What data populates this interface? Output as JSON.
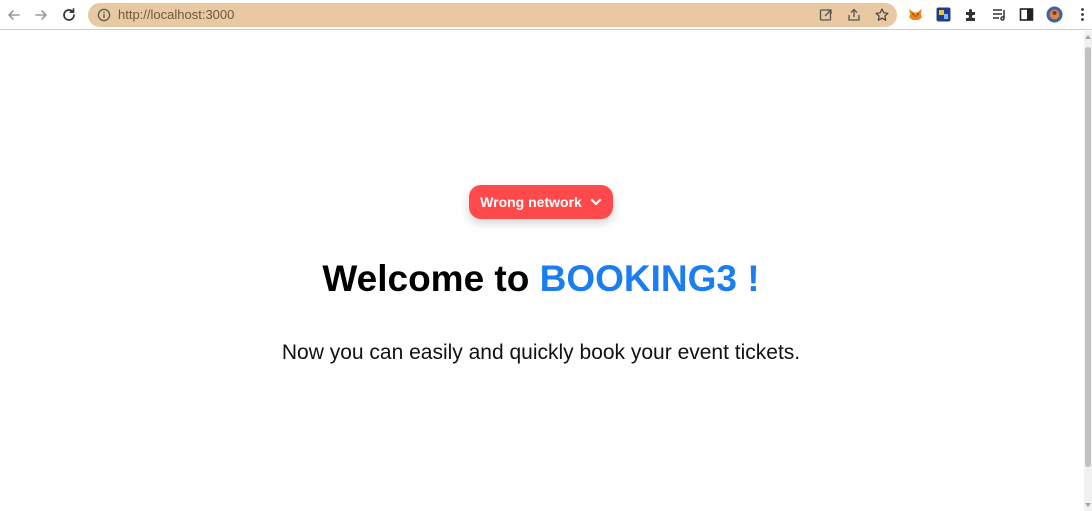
{
  "browser": {
    "url": "http://localhost:3000",
    "omnibox_color": "#e8c9a1"
  },
  "main": {
    "network_button_label": "Wrong network",
    "title_prefix": "Welcome to",
    "title_brand": "BOOKING3 !",
    "subtitle": "Now you can easily and quickly book your event tickets."
  },
  "colors": {
    "network_button": "#ff494a",
    "brand": "#1a7ef0"
  },
  "icons": {
    "back": "arrow-left-icon",
    "forward": "arrow-right-icon",
    "reload": "reload-icon",
    "site_info": "info-icon",
    "open_in_app": "open-external-icon",
    "share": "share-icon",
    "bookmark": "star-icon",
    "extensions": [
      "metamask-fox-icon",
      "extension-tile-icon",
      "puzzle-icon",
      "reading-list-icon",
      "side-panel-icon",
      "profile-avatar-icon",
      "kebab-menu-icon"
    ]
  }
}
